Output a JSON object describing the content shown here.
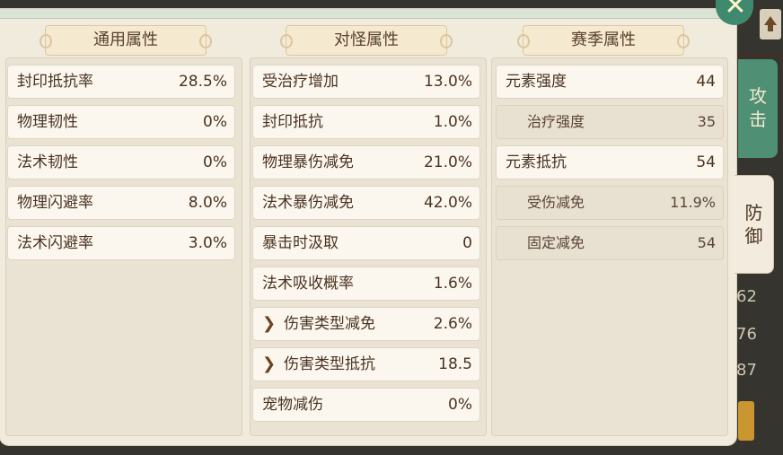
{
  "background_numbers": [
    "62",
    "76",
    "87"
  ],
  "columns": [
    {
      "title": "通用属性",
      "rows": [
        {
          "label": "封印抵抗率",
          "value": "28.5%"
        },
        {
          "label": "物理韧性",
          "value": "0%"
        },
        {
          "label": "法术韧性",
          "value": "0%"
        },
        {
          "label": "物理闪避率",
          "value": "8.0%"
        },
        {
          "label": "法术闪避率",
          "value": "3.0%"
        }
      ]
    },
    {
      "title": "对怪属性",
      "rows": [
        {
          "label": "受治疗增加",
          "value": "13.0%"
        },
        {
          "label": "封印抵抗",
          "value": "1.0%"
        },
        {
          "label": "物理暴伤减免",
          "value": "21.0%"
        },
        {
          "label": "法术暴伤减免",
          "value": "42.0%"
        },
        {
          "label": "暴击时汲取",
          "value": "0"
        },
        {
          "label": "法术吸收概率",
          "value": "1.6%"
        },
        {
          "label": "伤害类型减免",
          "value": "2.6%"
        },
        {
          "label": "伤害类型抵抗",
          "value": "18.5"
        },
        {
          "label": "宠物减伤",
          "value": "0%"
        }
      ]
    },
    {
      "title": "赛季属性",
      "rows": [
        {
          "label": "元素强度",
          "value": "44"
        },
        {
          "label": "治疗强度",
          "value": "35"
        },
        {
          "label": "元素抵抗",
          "value": "54"
        },
        {
          "label": "受伤减免",
          "value": "11.9%"
        },
        {
          "label": "固定减免",
          "value": "54"
        }
      ]
    }
  ],
  "tabs": {
    "attack": "攻击",
    "defense": "防御"
  },
  "colors": {
    "accent_green": "#4f8f73",
    "panel_bg": "#f1ebde",
    "header_gold": "#dcc79d",
    "text_brown": "#4a3322"
  },
  "icons": {
    "close": "close-icon",
    "expand": "chevron-right-icon",
    "scroll_top": "arrow-up-icon"
  }
}
